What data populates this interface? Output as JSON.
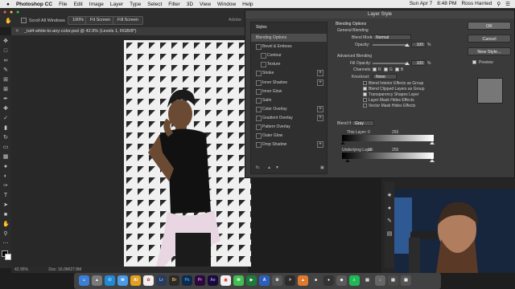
{
  "menubar": {
    "apple": "",
    "app": "Photoshop CC",
    "items": [
      "File",
      "Edit",
      "Image",
      "Layer",
      "Type",
      "Select",
      "Filter",
      "3D",
      "View",
      "Window",
      "Help"
    ],
    "right": [
      "Sun Apr 7",
      "8:48 PM",
      "Ross Harried"
    ]
  },
  "options": {
    "scroll_all": "Scroll All Windows",
    "zoom": "100%",
    "fit_screen": "Fit Screen",
    "fill_screen": "Fill Screen"
  },
  "document": {
    "tab": "_tut4-white-to-any-color.psd @ 42.9% (Levels 1, RGB/8*)",
    "app_title": "Adobe"
  },
  "status": {
    "zoom": "42.95%",
    "doc": "Doc: 16.0M/27.8M"
  },
  "dialog": {
    "title": "Layer Style",
    "styles_header": "Styles",
    "styles": [
      {
        "label": "Blending Options",
        "selected": true,
        "checkbox": false,
        "plus": false
      },
      {
        "label": "Bevel & Emboss",
        "checkbox": true,
        "plus": false
      },
      {
        "label": "Contour",
        "checkbox": true,
        "plus": false,
        "indent": true
      },
      {
        "label": "Texture",
        "checkbox": true,
        "plus": false,
        "indent": true
      },
      {
        "label": "Stroke",
        "checkbox": true,
        "plus": true
      },
      {
        "label": "Inner Shadow",
        "checkbox": true,
        "plus": true
      },
      {
        "label": "Inner Glow",
        "checkbox": true,
        "plus": false
      },
      {
        "label": "Satin",
        "checkbox": true,
        "plus": false
      },
      {
        "label": "Color Overlay",
        "checkbox": true,
        "plus": true
      },
      {
        "label": "Gradient Overlay",
        "checkbox": true,
        "plus": true
      },
      {
        "label": "Pattern Overlay",
        "checkbox": true,
        "plus": false
      },
      {
        "label": "Outer Glow",
        "checkbox": true,
        "plus": false
      },
      {
        "label": "Drop Shadow",
        "checkbox": true,
        "plus": true
      }
    ],
    "footer_fx": "fx.",
    "blending": {
      "header": "Blending Options",
      "general": "General Blending",
      "blend_mode_label": "Blend Mode:",
      "blend_mode": "Normal",
      "opacity_label": "Opacity:",
      "opacity": "100",
      "pct": "%",
      "advanced": "Advanced Blending",
      "fill_opacity_label": "Fill Opacity:",
      "fill_opacity": "100",
      "channels_label": "Channels:",
      "channels": [
        "R",
        "G",
        "B"
      ],
      "knockout_label": "Knockout:",
      "knockout": "None",
      "options": [
        {
          "label": "Blend Interior Effects as Group",
          "checked": false
        },
        {
          "label": "Blend Clipped Layers as Group",
          "checked": true
        },
        {
          "label": "Transparency Shapes Layer",
          "checked": true
        },
        {
          "label": "Layer Mask Hides Effects",
          "checked": false
        },
        {
          "label": "Vector Mask Hides Effects",
          "checked": false
        }
      ],
      "blend_if_label": "Blend If:",
      "blend_if": "Gray",
      "this_layer": "This Layer:",
      "this_min": "0",
      "this_max": "255",
      "underlying": "Underlying Layer:",
      "under_min": "15",
      "under_max": "255"
    },
    "buttons": {
      "ok": "OK",
      "cancel": "Cancel",
      "new_style": "New Style...",
      "preview": "Preview"
    },
    "preview_checked": true
  },
  "dock": [
    "Finder",
    "Launchpad",
    "Safari",
    "Mail",
    "Illustrator",
    "Photos",
    "Lightroom",
    "Bridge",
    "Photoshop",
    "Premiere",
    "After Effects",
    "Chrome",
    "Messages",
    "Spotify",
    "Trash"
  ],
  "colors": {
    "accent": "#4a8fe7",
    "dialog": "#3a3a3a",
    "menubar": "#e9e9e9"
  }
}
